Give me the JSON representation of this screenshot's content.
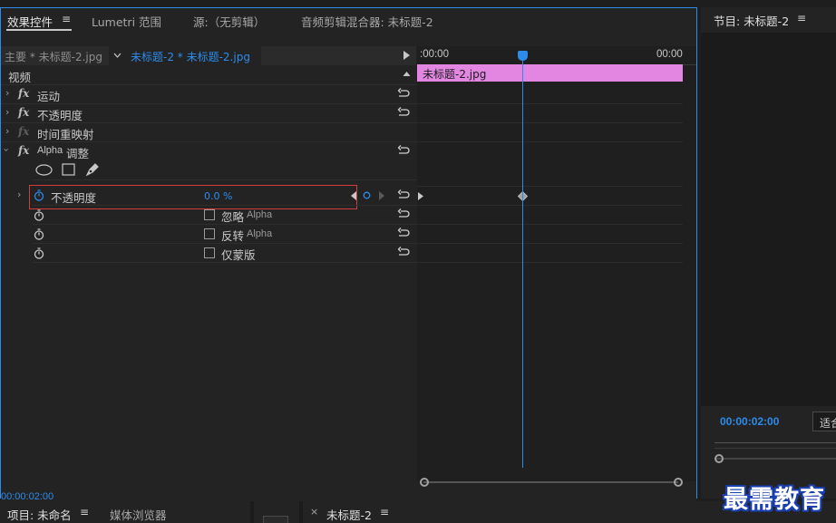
{
  "effect_controls": {
    "tabs": [
      {
        "label": "效果控件",
        "active": true
      },
      {
        "label": "Lumetri 范围",
        "active": false
      },
      {
        "label": "源:（无剪辑）",
        "active": false
      },
      {
        "label": "音频剪辑混合器: 未标题-2",
        "active": false
      }
    ],
    "menu_icon": "hamburger-menu-icon",
    "source_main": "主要 * 未标题-2.jpg",
    "source_clip": "未标题-2 * 未标题-2.jpg",
    "section_video": "视频",
    "properties": [
      {
        "label": "运动",
        "fx": "fx"
      },
      {
        "label": "不透明度",
        "fx": "fx"
      },
      {
        "label": "时间重映射",
        "fx": "fx"
      },
      {
        "label_latin": "Alpha",
        "label": "调整",
        "fx": "fx"
      }
    ],
    "opacity_param": {
      "label": "不透明度",
      "value": "0.0 %"
    },
    "checkboxes": [
      {
        "label": "忽略",
        "latin": "Alpha"
      },
      {
        "label": "反转",
        "latin": "Alpha"
      },
      {
        "label": "仅蒙版"
      }
    ],
    "timecode": "00:00:02:00",
    "timeline": {
      "ruler_start": ":00:00",
      "ruler_end": "00:00",
      "clip_label": "未标题-2.jpg"
    }
  },
  "program": {
    "title": "节目: 未标题-2",
    "timecode": "00:00:02:00",
    "fit_label": "适合"
  },
  "bottom": {
    "project_tab": "项目: 未命名",
    "media_browser_tab": "媒体浏览器",
    "sequence_tab": "未标题-2"
  },
  "watermark": "最需教育",
  "colors": {
    "accent": "#2d8ceb",
    "clip": "#e286e2",
    "highlight_box": "#d23c3c"
  }
}
